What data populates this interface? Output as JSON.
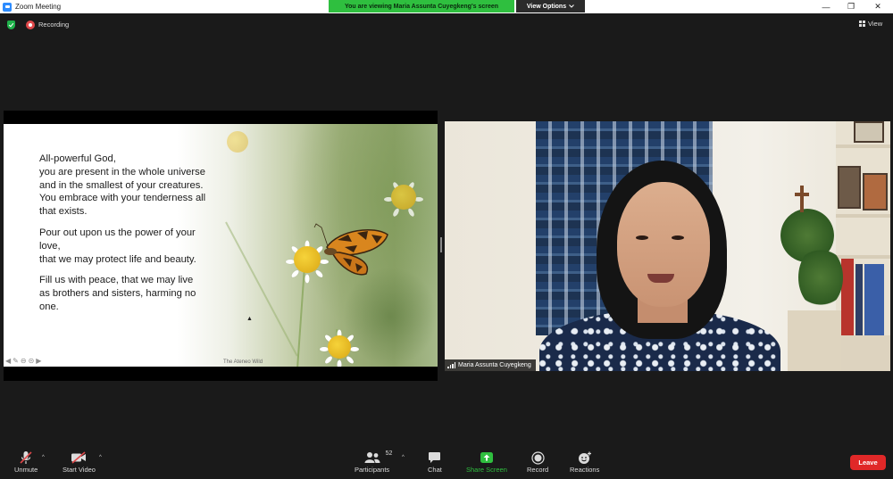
{
  "window": {
    "title": "Zoom Meeting",
    "viewing_banner": "You are viewing Maria Assunta Cuyegkeng's screen",
    "view_options_label": "View Options",
    "minimize": "—",
    "restore": "❐",
    "close": "✕"
  },
  "status": {
    "recording_label": "Recording",
    "view_label": "View"
  },
  "slide": {
    "paragraphs": [
      [
        "All-powerful God,",
        "you are present in the whole universe",
        "and in the smallest of your creatures.",
        "You embrace with your tenderness all",
        "that exists."
      ],
      [
        "Pour out upon us the power of your",
        "love,",
        "that we may protect life and beauty."
      ],
      [
        "Fill us with peace, that we may live",
        "as brothers and sisters, harming no",
        "one."
      ]
    ],
    "credit": "The Ateneo Wild"
  },
  "video": {
    "participant_name": "Maria Assunta Cuyegkeng"
  },
  "toolbar": {
    "unmute_label": "Unmute",
    "start_video_label": "Start Video",
    "participants_label": "Participants",
    "participants_count": "52",
    "chat_label": "Chat",
    "share_screen_label": "Share Screen",
    "record_label": "Record",
    "reactions_label": "Reactions",
    "leave_label": "Leave"
  },
  "colors": {
    "banner_green": "#2fbf3f",
    "leave_red": "#e02828",
    "recording_red": "#e0484a",
    "background": "#1a1a1a"
  },
  "icons": {
    "zoom_app": "zoom-app-icon",
    "security": "shield-icon",
    "recording": "record-dot-icon",
    "view": "grid-icon",
    "mic_muted": "mic-muted-icon",
    "video_off": "video-off-icon",
    "participants": "people-icon",
    "chat": "chat-bubble-icon",
    "share": "share-screen-icon",
    "record": "record-icon",
    "reactions": "smiley-plus-icon"
  }
}
